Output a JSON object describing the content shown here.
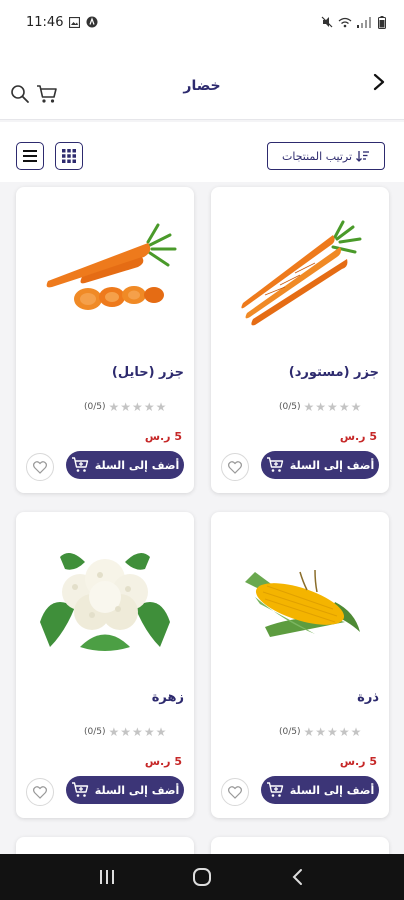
{
  "status_bar": {
    "time": "11:46"
  },
  "header": {
    "title": "خضار"
  },
  "toolbar": {
    "sort_label": "ترتيب المنتجات"
  },
  "products": [
    {
      "name": "جزر (مستورد)",
      "rating": "(0/5)",
      "price": "5 ر.س",
      "add_label": "أضف إلى السلة",
      "image": "carrots-bunch"
    },
    {
      "name": "جزر (حايل)",
      "rating": "(0/5)",
      "price": "5 ر.س",
      "add_label": "أضف إلى السلة",
      "image": "carrots-sliced"
    },
    {
      "name": "ذرة",
      "rating": "(0/5)",
      "price": "5 ر.س",
      "add_label": "أضف إلى السلة",
      "image": "corn"
    },
    {
      "name": "زهرة",
      "rating": "(0/5)",
      "price": "5 ر.س",
      "add_label": "أضف إلى السلة",
      "image": "cauliflower"
    }
  ],
  "colors": {
    "brand": "#3c3577",
    "title": "#2d2a6e",
    "price": "#c62828",
    "star": "#c4c4c4"
  }
}
